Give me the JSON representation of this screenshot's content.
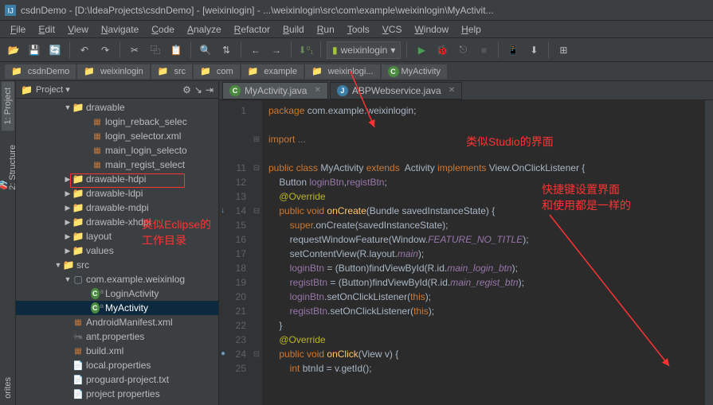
{
  "title": "csdnDemo - [D:\\IdeaProjects\\csdnDemo] - [weixinlogin] - ...\\weixinlogin\\src\\com\\example\\weixinlogin\\MyActivit...",
  "menu": [
    "File",
    "Edit",
    "View",
    "Navigate",
    "Code",
    "Analyze",
    "Refactor",
    "Build",
    "Run",
    "Tools",
    "VCS",
    "Window",
    "Help"
  ],
  "runconfig": "weixinlogin",
  "breadcrumbs": [
    {
      "t": "csdnDemo",
      "i": "folder"
    },
    {
      "t": "weixinlogin",
      "i": "folder"
    },
    {
      "t": "src",
      "i": "folder"
    },
    {
      "t": "com",
      "i": "folder"
    },
    {
      "t": "example",
      "i": "folder"
    },
    {
      "t": "weixinlogi...",
      "i": "folder"
    },
    {
      "t": "MyActivity",
      "i": "class"
    }
  ],
  "sidetabs": {
    "project": "1: Project",
    "structure": "2: Structure",
    "fav": "orites"
  },
  "project_header": {
    "label": "Project",
    "gear": "⚙"
  },
  "tree": [
    {
      "indent": 5,
      "arrow": "▼",
      "icon": "folder",
      "label": "drawable"
    },
    {
      "indent": 7,
      "icon": "xml",
      "label": "login_reback_selec"
    },
    {
      "indent": 7,
      "icon": "xml",
      "label": "login_selector.xml"
    },
    {
      "indent": 7,
      "icon": "xml",
      "label": "main_login_selecto"
    },
    {
      "indent": 7,
      "icon": "xml",
      "label": "main_regist_select"
    },
    {
      "indent": 5,
      "arrow": "▶",
      "icon": "folder",
      "label": "drawable-hdpi",
      "boxed": true
    },
    {
      "indent": 5,
      "arrow": "▶",
      "icon": "folder",
      "label": "drawable-ldpi"
    },
    {
      "indent": 5,
      "arrow": "▶",
      "icon": "folder",
      "label": "drawable-mdpi"
    },
    {
      "indent": 5,
      "arrow": "▶",
      "icon": "folder",
      "label": "drawable-xhdpi"
    },
    {
      "indent": 5,
      "arrow": "▶",
      "icon": "folder",
      "label": "layout"
    },
    {
      "indent": 5,
      "arrow": "▶",
      "icon": "folder",
      "label": "values"
    },
    {
      "indent": 4,
      "arrow": "▼",
      "icon": "folder",
      "label": "src"
    },
    {
      "indent": 5,
      "arrow": "▼",
      "icon": "pkg",
      "label": "com.example.weixinlog"
    },
    {
      "indent": 7,
      "icon": "class",
      "sub": "a",
      "label": "LoginActivity"
    },
    {
      "indent": 7,
      "icon": "class",
      "sub": "a",
      "label": "MyActivity",
      "selected": true
    },
    {
      "indent": 5,
      "icon": "xml",
      "label": "AndroidManifest.xml"
    },
    {
      "indent": 5,
      "icon": "ant",
      "label": "ant.properties"
    },
    {
      "indent": 5,
      "icon": "xml",
      "label": "build.xml"
    },
    {
      "indent": 5,
      "icon": "file",
      "label": "local.properties"
    },
    {
      "indent": 5,
      "icon": "file",
      "label": "proguard-project.txt"
    },
    {
      "indent": 5,
      "icon": "file",
      "label": "project properties"
    }
  ],
  "tabs": [
    {
      "icon": "class",
      "label": "MyActivity.java",
      "active": true
    },
    {
      "icon": "j",
      "label": "ABPWebservice.java",
      "active": false
    }
  ],
  "line_numbers": [
    1,
    "",
    "",
    "",
    11,
    12,
    13,
    14,
    15,
    16,
    17,
    18,
    19,
    20,
    21,
    22,
    23,
    24,
    25
  ],
  "code_lines": [
    {
      "html": "<span class='kw'>package</span> com.example.weixinlogin;"
    },
    {
      "html": ""
    },
    {
      "html": "<span class='kw'>import</span> <span class='comment'>...</span>",
      "fold": "+"
    },
    {
      "html": ""
    },
    {
      "html": "<span class='kw'>public class</span> MyActivity <span class='kw'>extends</span>  Activity <span class='kw'>implements</span> View.OnClickListener {"
    },
    {
      "html": "    Button <span class='field'>loginBtn</span>,<span class='field'>registBtn</span>;"
    },
    {
      "html": "    <span class='ann'>@Override</span>"
    },
    {
      "html": "    <span class='kw'>public void</span> <span class='fn'>onCreate</span>(Bundle savedInstanceState) {",
      "guttericon": "↓"
    },
    {
      "html": "        <span class='kw'>super</span>.onCreate(savedInstanceState);"
    },
    {
      "html": "        requestWindowFeature(Window.<span class='const'>FEATURE_NO_TITLE</span>);"
    },
    {
      "html": "        setContentView(R.layout.<span class='const'>main</span>);"
    },
    {
      "html": "        <span class='field'>loginBtn</span> = (Button)findViewById(R.id.<span class='const'>main_login_btn</span>);"
    },
    {
      "html": "        <span class='field'>registBtn</span> = (Button)findViewById(R.id.<span class='const'>main_regist_btn</span>);"
    },
    {
      "html": "        <span class='field'>loginBtn</span>.setOnClickListener(<span class='kw'>this</span>);"
    },
    {
      "html": "        <span class='field'>registBtn</span>.setOnClickListener(<span class='kw'>this</span>);"
    },
    {
      "html": "    }"
    },
    {
      "html": "    <span class='ann'>@Override</span>"
    },
    {
      "html": "    <span class='kw'>public void</span> <span class='fn'>onClick</span>(View v) {",
      "guttericon": "o"
    },
    {
      "html": "        <span class='kw'>int</span> btnId = v.getId();"
    }
  ],
  "annotations": {
    "eclipse": "类似Eclipse的\n工作目录",
    "studio": "类似Studio的界面",
    "shortcuts": "快捷键设置界面\n和使用都是一样的"
  }
}
